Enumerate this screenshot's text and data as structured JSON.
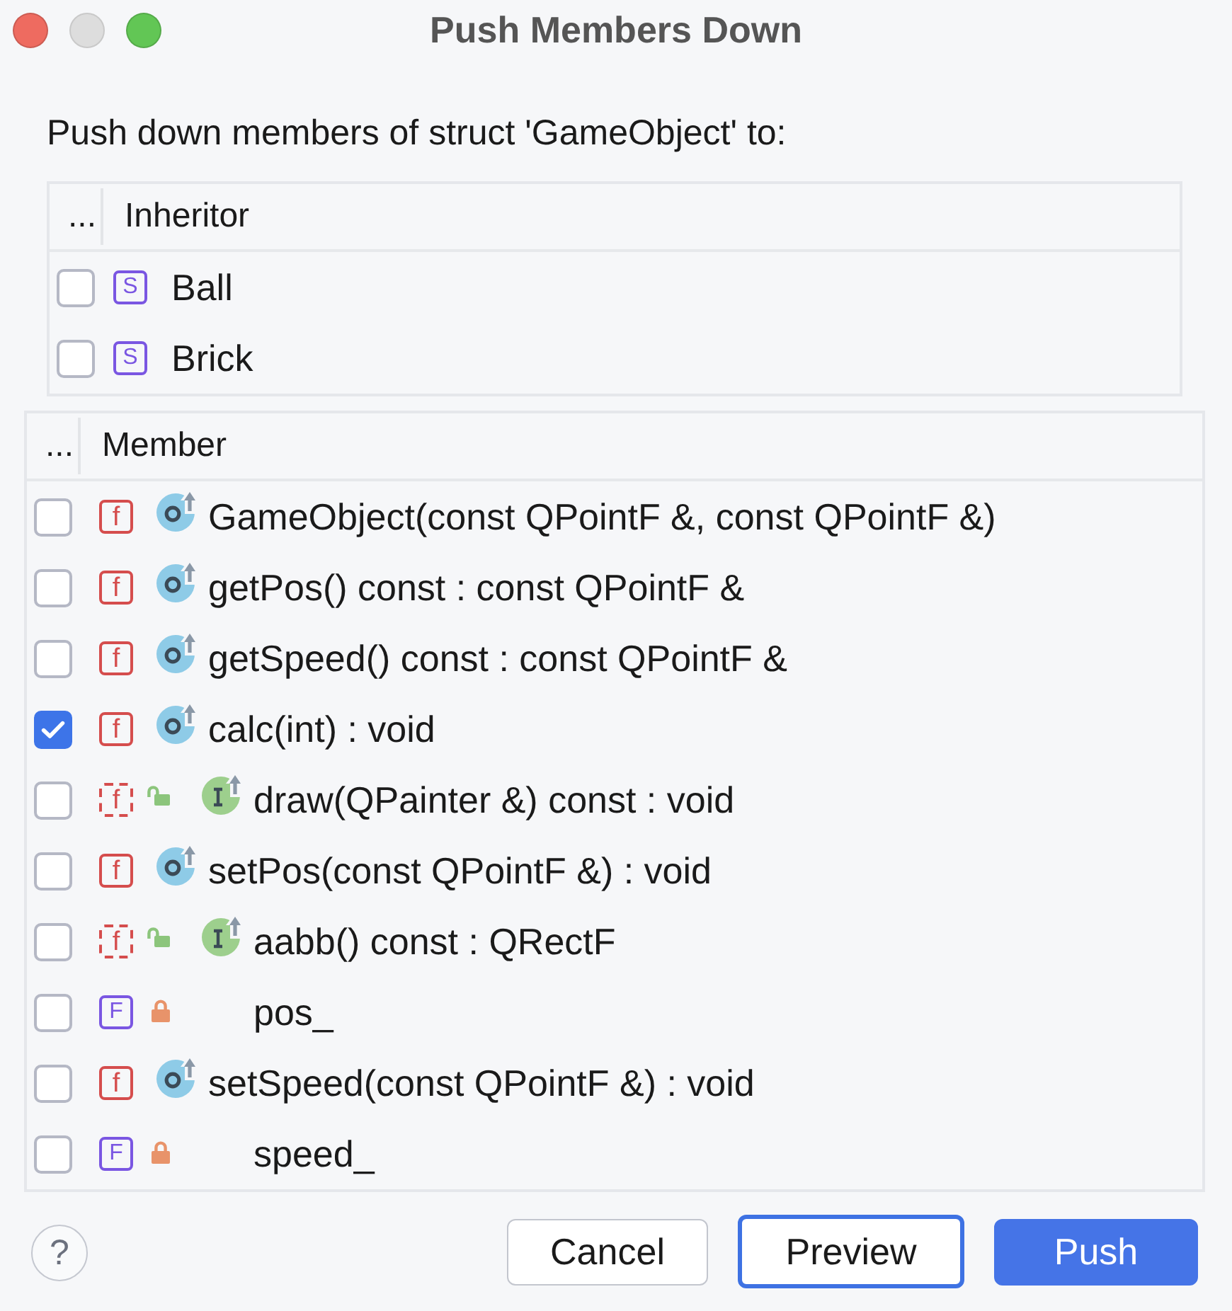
{
  "window": {
    "title": "Push Members Down",
    "controls": [
      {
        "kind": "close",
        "disabled": false
      },
      {
        "kind": "minimize",
        "disabled": true
      },
      {
        "kind": "zoom",
        "disabled": false
      }
    ]
  },
  "prompt": "Push down members of struct 'GameObject' to:",
  "inheritors": {
    "columns": [
      "...",
      "Inheritor"
    ],
    "rows": [
      {
        "checked": false,
        "tag": "S",
        "name": "Ball"
      },
      {
        "checked": false,
        "tag": "S",
        "name": "Brick"
      }
    ]
  },
  "members": {
    "columns": [
      "...",
      "Member"
    ],
    "rows": [
      {
        "checked": false,
        "kind": "method",
        "tag": "f",
        "icons": [
          {
            "kind": "override"
          }
        ],
        "name": "GameObject(const QPointF &, const QPointF &)"
      },
      {
        "checked": false,
        "kind": "method",
        "tag": "f",
        "icons": [
          {
            "kind": "override"
          }
        ],
        "name": "getPos() const : const QPointF &"
      },
      {
        "checked": false,
        "kind": "method",
        "tag": "f",
        "icons": [
          {
            "kind": "override"
          }
        ],
        "name": "getSpeed() const : const QPointF &"
      },
      {
        "checked": true,
        "kind": "method",
        "tag": "f",
        "icons": [
          {
            "kind": "override"
          }
        ],
        "name": "calc(int) : void"
      },
      {
        "checked": false,
        "kind": "abstract",
        "tag": "f",
        "icons": [
          {
            "kind": "unlocked"
          },
          {
            "kind": "implement"
          }
        ],
        "name": "draw(QPainter &) const : void"
      },
      {
        "checked": false,
        "kind": "method",
        "tag": "f",
        "icons": [
          {
            "kind": "override"
          }
        ],
        "name": "setPos(const QPointF &) : void"
      },
      {
        "checked": false,
        "kind": "abstract",
        "tag": "f",
        "icons": [
          {
            "kind": "unlocked"
          },
          {
            "kind": "implement"
          }
        ],
        "name": "aabb() const : QRectF"
      },
      {
        "checked": false,
        "kind": "field",
        "tag": "F",
        "icons": [
          {
            "kind": "locked"
          }
        ],
        "name": "pos_"
      },
      {
        "checked": false,
        "kind": "method",
        "tag": "f",
        "icons": [
          {
            "kind": "override"
          }
        ],
        "name": "setSpeed(const QPointF &) : void"
      },
      {
        "checked": false,
        "kind": "field",
        "tag": "F",
        "icons": [
          {
            "kind": "locked"
          }
        ],
        "name": "speed_"
      }
    ]
  },
  "footer": {
    "help": "?",
    "buttons": [
      {
        "label": "Cancel",
        "kind": "secondary",
        "focused": false
      },
      {
        "label": "Preview",
        "kind": "secondary",
        "focused": true
      },
      {
        "label": "Push",
        "kind": "primary",
        "focused": false
      }
    ]
  }
}
